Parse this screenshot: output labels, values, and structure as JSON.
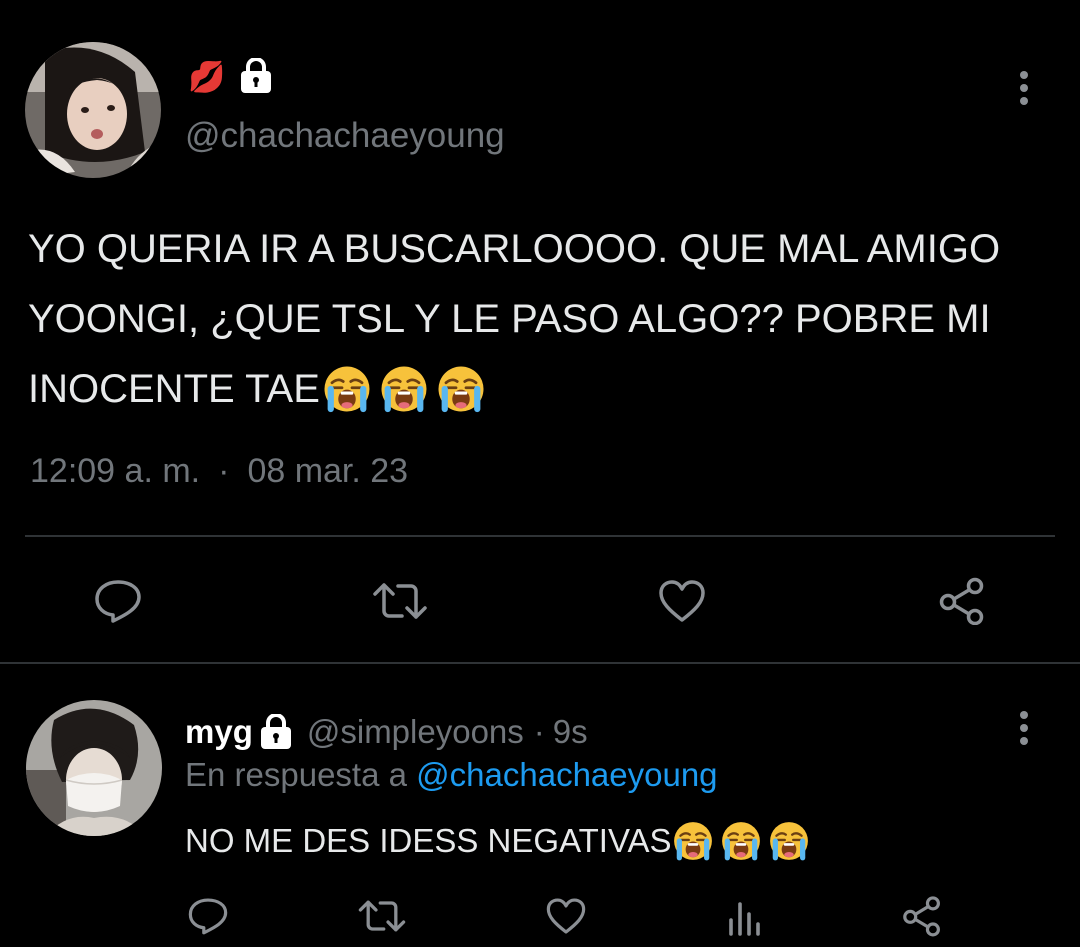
{
  "main_tweet": {
    "display_name_emoji": "💋",
    "handle": "@chachachaeyoung",
    "text_lines": [
      "YO QUERIA IR A BUSCARLOOOO. QUE MAL AMIGO",
      "YOONGI, ¿QUE TSL Y LE PASO ALGO?? POBRE MI",
      "INOCENTE TAE"
    ],
    "time": "12:09 a. m.",
    "separator": "·",
    "date": "08 mar. 23"
  },
  "reply": {
    "display_name": "myg",
    "handle": "@simpleyoons",
    "separator": "·",
    "age": "9s",
    "reply_prefix": "En respuesta a",
    "reply_to": "@chachachaeyoung",
    "text": "NO ME DES IDESS NEGATIVAS"
  },
  "colors": {
    "background": "#000000",
    "text": "#e7e9ea",
    "muted": "#71767b",
    "link": "#1d9bf0",
    "divider": "#2f3336"
  },
  "icons": {
    "lock": "lock-icon",
    "more": "more-vertical-icon",
    "reply": "reply-icon",
    "retweet": "retweet-icon",
    "like": "heart-icon",
    "share": "share-icon",
    "analytics": "analytics-icon",
    "crying": "loudly-crying-face-emoji"
  }
}
